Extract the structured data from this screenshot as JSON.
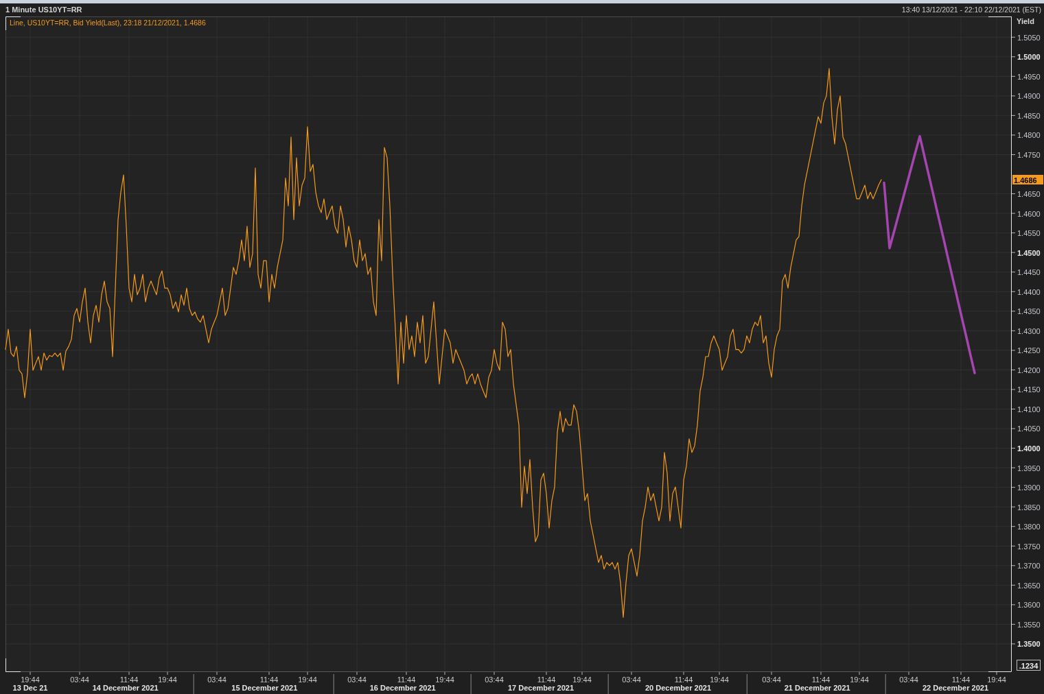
{
  "window": {
    "title": "1 Minute US10YT=RR",
    "time_range": "13:40 13/12/2021 - 22:10 22/12/2021 (EST)"
  },
  "chart": {
    "legend": {
      "before": "Line, US10YT=RR, ",
      "after": ", 23:18 21/12/2021, 1.4686"
    },
    "last_value": "1.4686",
    "precision_button": ".1234",
    "date_labels": [
      {
        "label": "13 Dec 21",
        "divider": false
      },
      {
        "label": "14 December 2021",
        "divider": true
      },
      {
        "label": "15 December 2021",
        "divider": true
      },
      {
        "label": "16 December 2021",
        "divider": true
      },
      {
        "label": "17 December 2021",
        "divider": true
      },
      {
        "label": "20 December 2021",
        "divider": true
      },
      {
        "label": "21 December 2021",
        "divider": true
      },
      {
        "label": "22 December 2021",
        "divider": false
      }
    ],
    "chart_data": {
      "type": "line",
      "ylabel": "Yield",
      "grid": true,
      "ylim": [
        1.3428,
        1.5103
      ],
      "yticks": [
        {
          "value": 1.35,
          "label": "1.3500"
        },
        {
          "value": 1.355,
          "label": "1.3550"
        },
        {
          "value": 1.36,
          "label": "1.3600"
        },
        {
          "value": 1.365,
          "label": "1.3650"
        },
        {
          "value": 1.37,
          "label": "1.3700"
        },
        {
          "value": 1.375,
          "label": "1.3750"
        },
        {
          "value": 1.38,
          "label": "1.3800"
        },
        {
          "value": 1.385,
          "label": "1.3850"
        },
        {
          "value": 1.39,
          "label": "1.3900"
        },
        {
          "value": 1.395,
          "label": "1.3950"
        },
        {
          "value": 1.4,
          "label": "1.4000"
        },
        {
          "value": 1.405,
          "label": "1.4050"
        },
        {
          "value": 1.41,
          "label": "1.4100"
        },
        {
          "value": 1.415,
          "label": "1.4150"
        },
        {
          "value": 1.42,
          "label": "1.4200"
        },
        {
          "value": 1.425,
          "label": "1.4250"
        },
        {
          "value": 1.43,
          "label": "1.4300"
        },
        {
          "value": 1.435,
          "label": "1.4350"
        },
        {
          "value": 1.44,
          "label": "1.4400"
        },
        {
          "value": 1.445,
          "label": "1.4450"
        },
        {
          "value": 1.45,
          "label": "1.4500"
        },
        {
          "value": 1.455,
          "label": "1.4550"
        },
        {
          "value": 1.46,
          "label": "1.4600"
        },
        {
          "value": 1.465,
          "label": "1.4650"
        },
        {
          "value": 1.475,
          "label": "1.4750"
        },
        {
          "value": 1.48,
          "label": "1.4800"
        },
        {
          "value": 1.485,
          "label": "1.4850"
        },
        {
          "value": 1.49,
          "label": "1.4900"
        },
        {
          "value": 1.495,
          "label": "1.4950"
        },
        {
          "value": 1.5,
          "label": "1.5000"
        },
        {
          "value": 1.505,
          "label": "1.5050"
        }
      ],
      "categories": [
        null,
        null,
        null,
        null,
        null,
        null,
        null,
        null,
        null,
        "19:44",
        null,
        null,
        null,
        null,
        null,
        null,
        null,
        null,
        null,
        null,
        null,
        null,
        null,
        null,
        null,
        null,
        null,
        "03:44",
        null,
        null,
        null,
        null,
        null,
        null,
        null,
        null,
        null,
        null,
        null,
        null,
        null,
        null,
        null,
        null,
        null,
        "11:44",
        null,
        null,
        null,
        null,
        null,
        null,
        null,
        null,
        null,
        null,
        null,
        null,
        null,
        "19:44",
        null,
        null,
        null,
        null,
        null,
        null,
        null,
        null,
        null,
        null,
        null,
        null,
        null,
        null,
        null,
        null,
        null,
        "03:44",
        null,
        null,
        null,
        null,
        null,
        null,
        null,
        null,
        null,
        null,
        null,
        null,
        null,
        null,
        null,
        null,
        null,
        null,
        "11:44",
        null,
        null,
        null,
        null,
        null,
        null,
        null,
        null,
        null,
        null,
        null,
        null,
        null,
        "19:44",
        null,
        null,
        null,
        null,
        null,
        null,
        null,
        null,
        null,
        null,
        null,
        null,
        null,
        null,
        null,
        null,
        null,
        "03:44",
        null,
        null,
        null,
        null,
        null,
        null,
        null,
        null,
        null,
        null,
        null,
        null,
        null,
        null,
        null,
        null,
        null,
        "11:44",
        null,
        null,
        null,
        null,
        null,
        null,
        null,
        null,
        null,
        null,
        null,
        null,
        null,
        "19:44",
        null,
        null,
        null,
        null,
        null,
        null,
        null,
        null,
        null,
        null,
        null,
        null,
        null,
        null,
        null,
        null,
        null,
        "03:44",
        null,
        null,
        null,
        null,
        null,
        null,
        null,
        null,
        null,
        null,
        null,
        null,
        null,
        null,
        null,
        null,
        null,
        null,
        "11:44",
        null,
        null,
        null,
        null,
        null,
        null,
        null,
        null,
        null,
        null,
        null,
        null,
        "19:44",
        null,
        null,
        null,
        null,
        null,
        null,
        null,
        null,
        null,
        null,
        null,
        null,
        null,
        null,
        null,
        null,
        null,
        "03:44",
        null,
        null,
        null,
        null,
        null,
        null,
        null,
        null,
        null,
        null,
        null,
        null,
        null,
        null,
        null,
        null,
        null,
        null,
        "11:44",
        null,
        null,
        null,
        null,
        null,
        null,
        null,
        null,
        null,
        null,
        null,
        null,
        "19:44",
        null,
        null,
        null,
        null,
        null,
        null,
        null,
        null,
        null,
        null,
        null,
        null,
        null,
        null,
        null,
        null,
        null,
        null,
        "03:44",
        null,
        null,
        null,
        null,
        null,
        null,
        null,
        null,
        null,
        null,
        null,
        null,
        null,
        null,
        null,
        null,
        null,
        "11:44",
        null,
        null,
        null,
        null,
        null,
        null,
        null,
        null,
        null,
        null,
        null,
        null,
        null,
        "19:44",
        null,
        null,
        null,
        null,
        null,
        null,
        null,
        null,
        null,
        null,
        null,
        null,
        null,
        null,
        null,
        null,
        null,
        "03:44",
        null,
        null,
        null,
        null,
        null,
        null,
        null,
        null,
        null,
        null,
        null,
        null,
        null,
        null,
        null,
        null,
        null,
        null,
        "11:44",
        null,
        null,
        null,
        null,
        null,
        null,
        null,
        null,
        null,
        null,
        null,
        null,
        "19:44",
        null,
        null,
        null,
        null,
        null
      ],
      "series": [
        {
          "name": "Bid Yield(Last)",
          "color": "#f59a1b",
          "values": [
            1.4252,
            1.4304,
            1.4243,
            1.4234,
            1.426,
            1.4199,
            1.419,
            1.4129,
            1.419,
            1.4304,
            1.4199,
            1.4217,
            1.4234,
            1.4199,
            1.4243,
            1.4225,
            1.4237,
            1.4234,
            1.4243,
            1.4234,
            1.4243,
            1.4199,
            1.4248,
            1.426,
            1.4278,
            1.4339,
            1.4357,
            1.4322,
            1.4374,
            1.4409,
            1.4322,
            1.4269,
            1.4339,
            1.4365,
            1.4322,
            1.4392,
            1.4427,
            1.4374,
            1.4357,
            1.4234,
            1.4409,
            1.4584,
            1.4654,
            1.4698,
            1.4567,
            1.4409,
            1.4374,
            1.4444,
            1.4392,
            1.4409,
            1.4444,
            1.4374,
            1.4409,
            1.4427,
            1.4409,
            1.4392,
            1.4435,
            1.4453,
            1.4409,
            1.4409,
            1.4392,
            1.4357,
            1.4374,
            1.4348,
            1.4392,
            1.4365,
            1.4409,
            1.4357,
            1.4339,
            1.4348,
            1.433,
            1.4322,
            1.4339,
            1.4304,
            1.4269,
            1.4304,
            1.4322,
            1.4339,
            1.4374,
            1.4409,
            1.4339,
            1.4357,
            1.4409,
            1.4462,
            1.4444,
            1.4479,
            1.4532,
            1.4479,
            1.4567,
            1.4462,
            1.4497,
            1.4716,
            1.4444,
            1.4409,
            1.4479,
            1.4479,
            1.4374,
            1.4444,
            1.4409,
            1.4462,
            1.4497,
            1.4532,
            1.469,
            1.4619,
            1.4795,
            1.4584,
            1.4742,
            1.4619,
            1.4672,
            1.469,
            1.4821,
            1.4707,
            1.4725,
            1.4654,
            1.4619,
            1.4602,
            1.4637,
            1.4584,
            1.4602,
            1.4619,
            1.4567,
            1.4549,
            1.4619,
            1.4584,
            1.4514,
            1.4567,
            1.4532,
            1.4479,
            1.4462,
            1.4532,
            1.4479,
            1.4497,
            1.4444,
            1.4462,
            1.4374,
            1.4339,
            1.4584,
            1.4479,
            1.4768,
            1.4742,
            1.4619,
            1.4444,
            1.4304,
            1.4164,
            1.4322,
            1.4217,
            1.4339,
            1.4252,
            1.4287,
            1.4234,
            1.4322,
            1.4269,
            1.4339,
            1.4217,
            1.4234,
            1.4304,
            1.4374,
            1.4269,
            1.4164,
            1.4234,
            1.4304,
            1.4287,
            1.4269,
            1.4217,
            1.4252,
            1.4234,
            1.4217,
            1.4199,
            1.4164,
            1.4181,
            1.419,
            1.4164,
            1.419,
            1.4164,
            1.4146,
            1.4129,
            1.4181,
            1.4199,
            1.4252,
            1.4217,
            1.4199,
            1.4322,
            1.4304,
            1.4234,
            1.4252,
            1.4164,
            1.4111,
            1.4059,
            1.3849,
            1.3954,
            1.3884,
            1.3971,
            1.3849,
            1.3761,
            1.3779,
            1.3919,
            1.3936,
            1.3884,
            1.3796,
            1.3866,
            1.3901,
            1.4041,
            1.4094,
            1.4041,
            1.4076,
            1.4059,
            1.4059,
            1.4111,
            1.4094,
            1.4041,
            1.3954,
            1.3866,
            1.3884,
            1.3814,
            1.3779,
            1.3743,
            1.3708,
            1.3726,
            1.3691,
            1.3708,
            1.37,
            1.3708,
            1.3691,
            1.3708,
            1.3656,
            1.3568,
            1.3656,
            1.3726,
            1.3743,
            1.3708,
            1.3673,
            1.3726,
            1.3814,
            1.3849,
            1.3901,
            1.3866,
            1.3884,
            1.3849,
            1.3814,
            1.3849,
            1.3989,
            1.3936,
            1.3814,
            1.3884,
            1.3901,
            1.3849,
            1.3796,
            1.3919,
            1.3954,
            1.4024,
            1.3989,
            1.4006,
            1.4059,
            1.4146,
            1.4181,
            1.4234,
            1.4234,
            1.4269,
            1.4287,
            1.4269,
            1.4252,
            1.4199,
            1.4217,
            1.4234,
            1.4287,
            1.4304,
            1.4252,
            1.4252,
            1.4243,
            1.4252,
            1.4287,
            1.4269,
            1.4304,
            1.4322,
            1.4313,
            1.4339,
            1.4269,
            1.4287,
            1.4217,
            1.4181,
            1.4252,
            1.4287,
            1.4304,
            1.4427,
            1.4444,
            1.4409,
            1.4462,
            1.4497,
            1.4532,
            1.4541,
            1.4619,
            1.4672,
            1.4707,
            1.4742,
            1.4777,
            1.4812,
            1.4847,
            1.483,
            1.4882,
            1.49,
            1.497,
            1.4847,
            1.4777,
            1.4865,
            1.49,
            1.4795,
            1.4777,
            1.4742,
            1.4707,
            1.4672,
            1.4637,
            1.4637,
            1.4654,
            1.4672,
            1.4637,
            1.4654,
            1.4637,
            1.4654,
            1.4672,
            1.4686,
            null,
            null,
            null,
            null,
            null,
            null,
            null,
            null,
            null,
            null,
            null,
            null,
            null,
            null,
            null,
            null,
            null,
            null,
            null,
            null,
            null,
            null,
            null,
            null,
            null,
            null,
            null,
            null,
            null,
            null,
            null,
            null,
            null,
            null,
            null,
            null,
            null,
            null,
            null,
            null,
            null,
            null,
            null,
            null,
            null,
            null,
            null
          ]
        },
        {
          "color": "#a445b0",
          "values": [
            null,
            null,
            null,
            null,
            null,
            null,
            null,
            null,
            null,
            null,
            null,
            null,
            null,
            null,
            null,
            null,
            null,
            null,
            null,
            null,
            null,
            null,
            null,
            null,
            null,
            null,
            null,
            null,
            null,
            null,
            null,
            null,
            null,
            null,
            null,
            null,
            null,
            null,
            null,
            null,
            null,
            null,
            null,
            null,
            null,
            null,
            null,
            null,
            null,
            null,
            null,
            null,
            null,
            null,
            null,
            null,
            null,
            null,
            null,
            null,
            null,
            null,
            null,
            null,
            null,
            null,
            null,
            null,
            null,
            null,
            null,
            null,
            null,
            null,
            null,
            null,
            null,
            null,
            null,
            null,
            null,
            null,
            null,
            null,
            null,
            null,
            null,
            null,
            null,
            null,
            null,
            null,
            null,
            null,
            null,
            null,
            null,
            null,
            null,
            null,
            null,
            null,
            null,
            null,
            null,
            null,
            null,
            null,
            null,
            null,
            null,
            null,
            null,
            null,
            null,
            null,
            null,
            null,
            null,
            null,
            null,
            null,
            null,
            null,
            null,
            null,
            null,
            null,
            null,
            null,
            null,
            null,
            null,
            null,
            null,
            null,
            null,
            null,
            null,
            null,
            null,
            null,
            null,
            null,
            null,
            null,
            null,
            null,
            null,
            null,
            null,
            null,
            null,
            null,
            null,
            null,
            null,
            null,
            null,
            null,
            null,
            null,
            null,
            null,
            null,
            null,
            null,
            null,
            null,
            null,
            null,
            null,
            null,
            null,
            null,
            null,
            null,
            null,
            null,
            null,
            null,
            null,
            null,
            null,
            null,
            null,
            null,
            null,
            null,
            null,
            null,
            null,
            null,
            null,
            null,
            null,
            null,
            null,
            null,
            null,
            null,
            null,
            null,
            null,
            null,
            null,
            null,
            null,
            null,
            null,
            null,
            null,
            null,
            null,
            null,
            null,
            null,
            null,
            null,
            null,
            null,
            null,
            null,
            null,
            null,
            null,
            null,
            null,
            null,
            null,
            null,
            null,
            null,
            null,
            null,
            null,
            null,
            null,
            null,
            null,
            null,
            null,
            null,
            null,
            null,
            null,
            null,
            null,
            null,
            null,
            null,
            null,
            null,
            null,
            null,
            null,
            null,
            null,
            null,
            null,
            null,
            null,
            null,
            null,
            null,
            null,
            null,
            null,
            null,
            null,
            null,
            null,
            null,
            null,
            null,
            null,
            null,
            null,
            null,
            null,
            null,
            null,
            null,
            null,
            null,
            null,
            null,
            null,
            null,
            null,
            null,
            null,
            null,
            null,
            null,
            null,
            null,
            null,
            null,
            null,
            null,
            null,
            null,
            null,
            null,
            null,
            null,
            null,
            null,
            null,
            null,
            null,
            null,
            null,
            null,
            null,
            null,
            null,
            null,
            null,
            1.4678,
            1.4595,
            1.4511,
            1.4537,
            1.4563,
            1.4589,
            1.4615,
            1.4641,
            1.4667,
            1.4693,
            1.4719,
            1.4745,
            1.4771,
            1.4797,
            1.4767,
            1.4736,
            1.4706,
            1.4676,
            1.4646,
            1.4615,
            1.4585,
            1.4555,
            1.4525,
            1.4494,
            1.4464,
            1.4434,
            1.4404,
            1.4373,
            1.4343,
            1.4313,
            1.4283,
            1.4252,
            1.4222,
            1.4192,
            null,
            null,
            null,
            null,
            null,
            null,
            null,
            null,
            null,
            null,
            null,
            null,
            null
          ]
        }
      ]
    }
  }
}
